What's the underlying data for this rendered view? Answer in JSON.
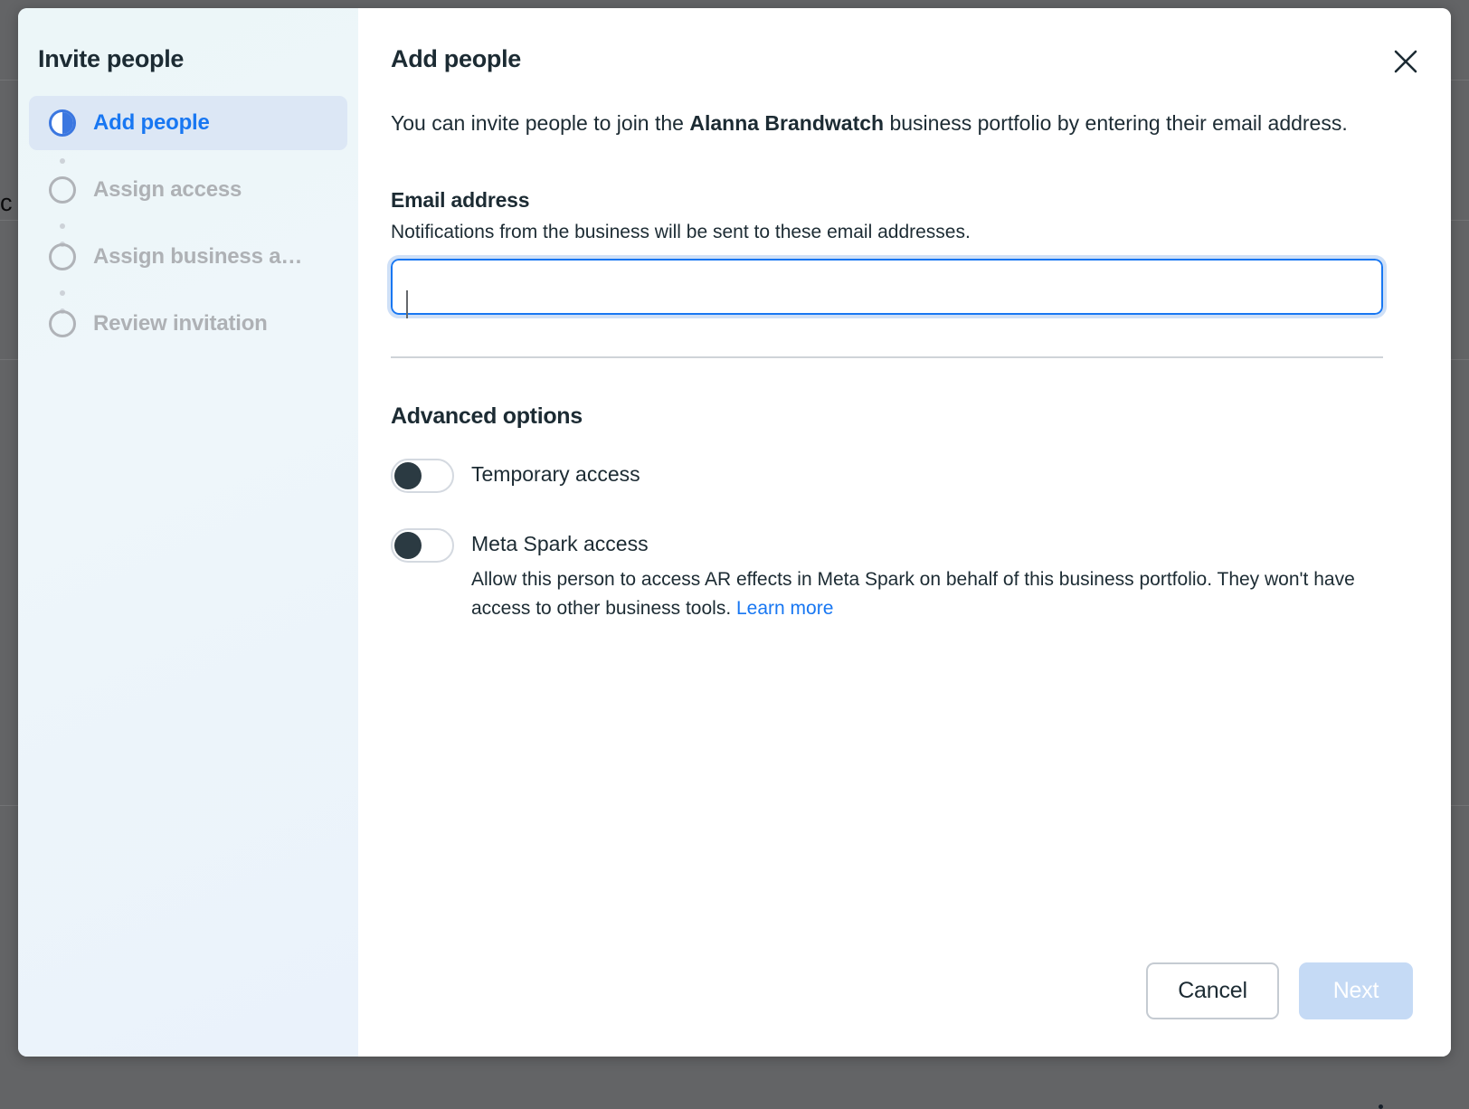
{
  "dialog": {
    "sidebar": {
      "title": "Invite people",
      "steps": [
        {
          "label": "Add people",
          "state": "current",
          "icon": "half-filled-circle-icon"
        },
        {
          "label": "Assign access",
          "state": "todo",
          "icon": "empty-circle-icon"
        },
        {
          "label": "Assign business a…",
          "state": "todo",
          "icon": "empty-circle-icon"
        },
        {
          "label": "Review invitation",
          "state": "todo",
          "icon": "empty-circle-icon"
        }
      ]
    },
    "content": {
      "title": "Add people",
      "close_icon": "close-icon",
      "intro_before": "You can invite people to join the ",
      "intro_bold": "Alanna Brandwatch",
      "intro_after": " business portfolio by entering their email address.",
      "email": {
        "label": "Email address",
        "help": "Notifications from the business will be sent to these email addresses.",
        "value": "",
        "placeholder": "",
        "focused": true
      },
      "advanced": {
        "title": "Advanced options",
        "options": [
          {
            "label": "Temporary access",
            "enabled": false,
            "description": "",
            "link_text": ""
          },
          {
            "label": "Meta Spark access",
            "enabled": false,
            "description": "Allow this person to access AR effects in Meta Spark on behalf of this business portfolio. They won't have access to other business tools. ",
            "link_text": "Learn more"
          }
        ]
      }
    },
    "footer": {
      "cancel_label": "Cancel",
      "next_label": "Next",
      "next_disabled": true
    }
  },
  "backdrop": {
    "glyph": "c"
  },
  "colors": {
    "accent_blue": "#1877f2",
    "step_blue": "#3b77e0",
    "text_dark": "#1c2b33",
    "muted_gray": "#aeb1b5",
    "next_disabled_bg": "#c5daf5",
    "overlay": "#636466"
  }
}
